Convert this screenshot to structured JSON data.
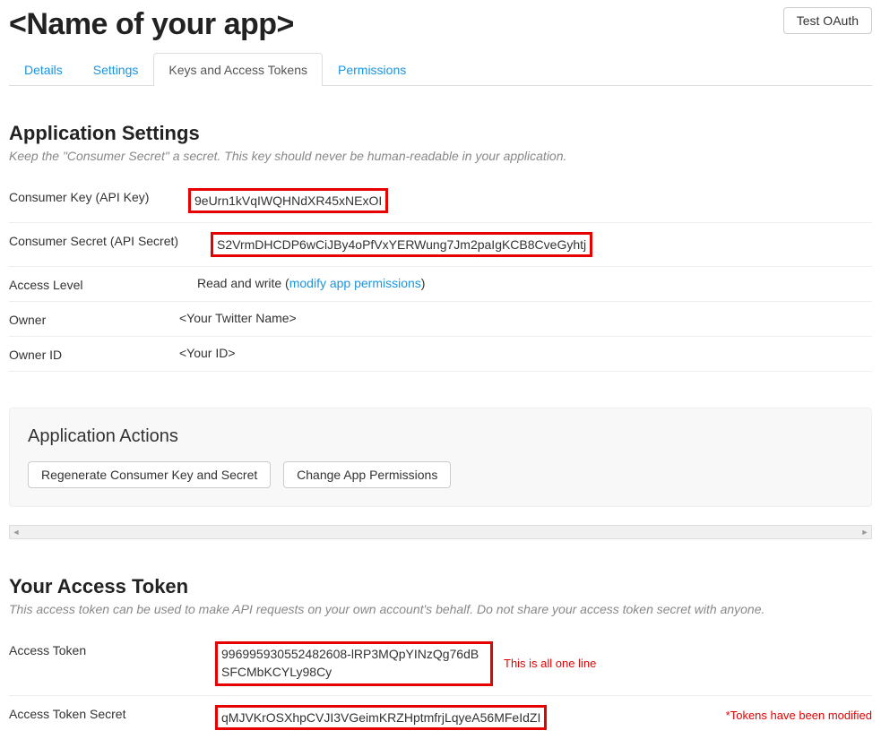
{
  "header": {
    "title": "<Name of your app>",
    "test_oauth_label": "Test OAuth"
  },
  "tabs": {
    "details": "Details",
    "settings": "Settings",
    "keys_tokens": "Keys and Access Tokens",
    "permissions": "Permissions"
  },
  "app_settings": {
    "heading": "Application Settings",
    "subtitle": "Keep the \"Consumer Secret\" a secret. This key should never be human-readable in your application.",
    "consumer_key_label": "Consumer Key (API Key)",
    "consumer_key_value": "9eUrn1kVqIWQHNdXR45xNExOI",
    "consumer_secret_label": "Consumer Secret (API Secret)",
    "consumer_secret_value": "S2VrmDHCDP6wCiJBy4oPfVxYERWung7Jm2paIgKCB8CveGyhtj",
    "access_level_label": "Access Level",
    "access_level_value_prefix": "Read and write (",
    "access_level_link": "modify app permissions",
    "access_level_value_suffix": ")",
    "owner_label": "Owner",
    "owner_value": "<Your Twitter Name>",
    "owner_id_label": "Owner ID",
    "owner_id_value": "<Your ID>"
  },
  "actions": {
    "heading": "Application Actions",
    "regenerate_label": "Regenerate Consumer Key and Secret",
    "change_perms_label": "Change App Permissions"
  },
  "access_token": {
    "heading": "Your Access Token",
    "subtitle": "This access token can be used to make API requests on your own account's behalf. Do not share your access token secret with anyone.",
    "token_label": "Access Token",
    "token_value": "996995930552482608-lRP3MQpYINzQg76dBSFCMbKCYLy98Cy",
    "token_note": "This is all one line",
    "token_secret_label": "Access Token Secret",
    "token_secret_value": "qMJVKrOSXhpCVJI3VGeimKRZHptmfrjLqyeA56MFeIdZI",
    "modified_note": "*Tokens have been modified"
  }
}
